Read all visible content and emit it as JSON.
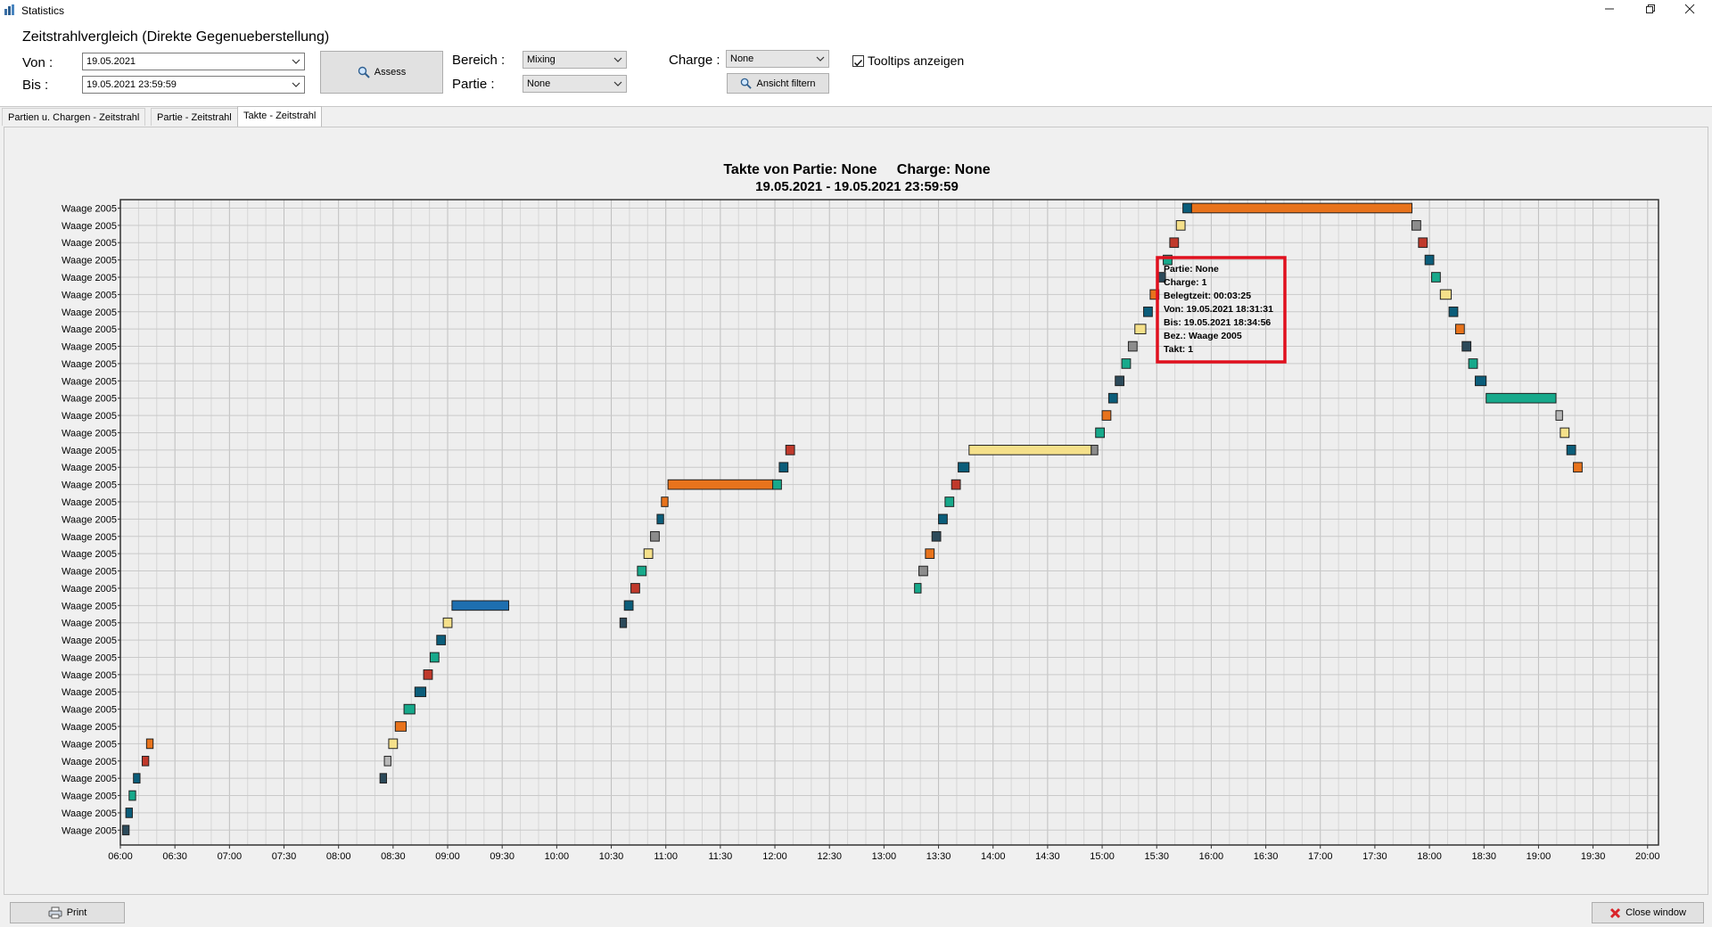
{
  "window": {
    "title": "Statistics",
    "minimize_icon": "minimize-icon",
    "maximize_icon": "restore-icon",
    "close_icon": "close-icon"
  },
  "filter": {
    "heading": "Zeitstrahlvergleich (Direkte Gegenueberstellung)",
    "von_label": "Von :",
    "von_value": "19.05.2021",
    "bis_label": "Bis :",
    "bis_value": "19.05.2021 23:59:59",
    "assess_label": "Assess",
    "bereich_label": "Bereich :",
    "bereich_value": "Mixing",
    "partie_label": "Partie :",
    "partie_value": "None",
    "charge_label": "Charge :",
    "charge_value": "None",
    "ansicht_label": "Ansicht filtern",
    "tooltips_label": "Tooltips anzeigen",
    "tooltips_checked": true
  },
  "tabs": [
    {
      "label": "Partien u. Chargen - Zeitstrahl",
      "active": false
    },
    {
      "label": "Partie - Zeitstrahl",
      "active": false
    },
    {
      "label": "Takte - Zeitstrahl",
      "active": true
    }
  ],
  "chart_data": {
    "type": "timeline",
    "title": "Takte von Partie: None     Charge: None",
    "subtitle": "19.05.2021 - 19.05.2021 23:59:59",
    "x_ticks": [
      "06:00",
      "06:30",
      "07:00",
      "07:30",
      "08:00",
      "08:30",
      "09:00",
      "09:30",
      "10:00",
      "10:30",
      "11:00",
      "11:30",
      "12:00",
      "12:30",
      "13:00",
      "13:30",
      "14:00",
      "14:30",
      "15:00",
      "15:30",
      "16:00",
      "16:30",
      "17:00",
      "17:30",
      "18:00",
      "18:30",
      "19:00",
      "19:30",
      "20:00"
    ],
    "x_range_hours": [
      6.0,
      20.1
    ],
    "y_label": "Waage 2005",
    "row_count": 37,
    "grid": true,
    "palette": [
      "#0b5d7a",
      "#17a98b",
      "#e8731c",
      "#c0392b",
      "#f5e08a",
      "#8c8c8c",
      "#2c4a5a",
      "#1e6fb0",
      "#b8b8b8"
    ],
    "segments": [
      {
        "row": 1,
        "start": 6.02,
        "end": 6.08,
        "color": "#2c4a5a"
      },
      {
        "row": 2,
        "start": 6.05,
        "end": 6.11,
        "color": "#0b5d7a"
      },
      {
        "row": 3,
        "start": 6.08,
        "end": 6.14,
        "color": "#17a98b"
      },
      {
        "row": 4,
        "start": 6.12,
        "end": 6.18,
        "color": "#0b5d7a"
      },
      {
        "row": 5,
        "start": 6.2,
        "end": 6.26,
        "color": "#c0392b"
      },
      {
        "row": 6,
        "start": 6.24,
        "end": 6.3,
        "color": "#e8731c"
      },
      {
        "row": 4,
        "start": 8.38,
        "end": 8.44,
        "color": "#2c4a5a"
      },
      {
        "row": 5,
        "start": 8.42,
        "end": 8.48,
        "color": "#b8b8b8"
      },
      {
        "row": 6,
        "start": 8.46,
        "end": 8.54,
        "color": "#f5e08a"
      },
      {
        "row": 7,
        "start": 8.52,
        "end": 8.62,
        "color": "#e8731c"
      },
      {
        "row": 8,
        "start": 8.6,
        "end": 8.7,
        "color": "#17a98b"
      },
      {
        "row": 9,
        "start": 8.7,
        "end": 8.8,
        "color": "#0b5d7a"
      },
      {
        "row": 10,
        "start": 8.78,
        "end": 8.86,
        "color": "#c0392b"
      },
      {
        "row": 11,
        "start": 8.84,
        "end": 8.92,
        "color": "#17a98b"
      },
      {
        "row": 12,
        "start": 8.9,
        "end": 8.98,
        "color": "#0b5d7a"
      },
      {
        "row": 13,
        "start": 8.96,
        "end": 9.04,
        "color": "#f5e08a"
      },
      {
        "row": 14,
        "start": 9.04,
        "end": 9.56,
        "color": "#1e6fb0"
      },
      {
        "row": 13,
        "start": 10.58,
        "end": 10.64,
        "color": "#2c4a5a"
      },
      {
        "row": 14,
        "start": 10.62,
        "end": 10.7,
        "color": "#0b5d7a"
      },
      {
        "row": 15,
        "start": 10.68,
        "end": 10.76,
        "color": "#c0392b"
      },
      {
        "row": 16,
        "start": 10.74,
        "end": 10.82,
        "color": "#17a98b"
      },
      {
        "row": 17,
        "start": 10.8,
        "end": 10.88,
        "color": "#f5e08a"
      },
      {
        "row": 18,
        "start": 10.86,
        "end": 10.94,
        "color": "#8c8c8c"
      },
      {
        "row": 19,
        "start": 10.92,
        "end": 10.98,
        "color": "#0b5d7a"
      },
      {
        "row": 20,
        "start": 10.96,
        "end": 11.02,
        "color": "#e8731c"
      },
      {
        "row": 21,
        "start": 11.02,
        "end": 11.98,
        "color": "#e8731c"
      },
      {
        "row": 21,
        "start": 11.98,
        "end": 12.06,
        "color": "#17a98b"
      },
      {
        "row": 22,
        "start": 12.04,
        "end": 12.12,
        "color": "#0b5d7a"
      },
      {
        "row": 23,
        "start": 12.1,
        "end": 12.18,
        "color": "#c0392b"
      },
      {
        "row": 15,
        "start": 13.28,
        "end": 13.34,
        "color": "#17a98b"
      },
      {
        "row": 16,
        "start": 13.32,
        "end": 13.4,
        "color": "#8c8c8c"
      },
      {
        "row": 17,
        "start": 13.38,
        "end": 13.46,
        "color": "#e8731c"
      },
      {
        "row": 18,
        "start": 13.44,
        "end": 13.52,
        "color": "#2c4a5a"
      },
      {
        "row": 19,
        "start": 13.5,
        "end": 13.58,
        "color": "#0b5d7a"
      },
      {
        "row": 20,
        "start": 13.56,
        "end": 13.64,
        "color": "#17a98b"
      },
      {
        "row": 21,
        "start": 13.62,
        "end": 13.7,
        "color": "#c0392b"
      },
      {
        "row": 22,
        "start": 13.68,
        "end": 13.78,
        "color": "#0b5d7a"
      },
      {
        "row": 23,
        "start": 13.78,
        "end": 14.9,
        "color": "#f5e08a"
      },
      {
        "row": 23,
        "start": 14.9,
        "end": 14.96,
        "color": "#8c8c8c"
      },
      {
        "row": 24,
        "start": 14.94,
        "end": 15.02,
        "color": "#17a98b"
      },
      {
        "row": 25,
        "start": 15.0,
        "end": 15.08,
        "color": "#e8731c"
      },
      {
        "row": 26,
        "start": 15.06,
        "end": 15.14,
        "color": "#0b5d7a"
      },
      {
        "row": 27,
        "start": 15.12,
        "end": 15.2,
        "color": "#2c4a5a"
      },
      {
        "row": 28,
        "start": 15.18,
        "end": 15.26,
        "color": "#17a98b"
      },
      {
        "row": 29,
        "start": 15.24,
        "end": 15.32,
        "color": "#8c8c8c"
      },
      {
        "row": 30,
        "start": 15.3,
        "end": 15.4,
        "color": "#f5e08a"
      },
      {
        "row": 31,
        "start": 15.38,
        "end": 15.46,
        "color": "#0b5d7a"
      },
      {
        "row": 32,
        "start": 15.44,
        "end": 15.52,
        "color": "#e8731c"
      },
      {
        "row": 33,
        "start": 15.5,
        "end": 15.58,
        "color": "#2c4a5a"
      },
      {
        "row": 34,
        "start": 15.56,
        "end": 15.64,
        "color": "#17a98b"
      },
      {
        "row": 35,
        "start": 15.62,
        "end": 15.7,
        "color": "#c0392b"
      },
      {
        "row": 36,
        "start": 15.68,
        "end": 15.76,
        "color": "#f5e08a"
      },
      {
        "row": 37,
        "start": 15.74,
        "end": 15.82,
        "color": "#0b5d7a"
      },
      {
        "row": 37,
        "start": 15.82,
        "end": 17.84,
        "color": "#e8731c"
      },
      {
        "row": 36,
        "start": 17.84,
        "end": 17.92,
        "color": "#8c8c8c"
      },
      {
        "row": 35,
        "start": 17.9,
        "end": 17.98,
        "color": "#c0392b"
      },
      {
        "row": 34,
        "start": 17.96,
        "end": 18.04,
        "color": "#0b5d7a"
      },
      {
        "row": 33,
        "start": 18.02,
        "end": 18.1,
        "color": "#17a98b"
      },
      {
        "row": 32,
        "start": 18.1,
        "end": 18.2,
        "color": "#f5e08a"
      },
      {
        "row": 31,
        "start": 18.18,
        "end": 18.26,
        "color": "#0b5d7a"
      },
      {
        "row": 30,
        "start": 18.24,
        "end": 18.32,
        "color": "#e8731c"
      },
      {
        "row": 29,
        "start": 18.3,
        "end": 18.38,
        "color": "#2c4a5a"
      },
      {
        "row": 28,
        "start": 18.36,
        "end": 18.44,
        "color": "#17a98b"
      },
      {
        "row": 27,
        "start": 18.42,
        "end": 18.52,
        "color": "#0b5d7a"
      },
      {
        "row": 26,
        "start": 18.52,
        "end": 19.16,
        "color": "#17a98b"
      },
      {
        "row": 25,
        "start": 19.16,
        "end": 19.22,
        "color": "#b8b8b8"
      },
      {
        "row": 24,
        "start": 19.2,
        "end": 19.28,
        "color": "#f5e08a"
      },
      {
        "row": 23,
        "start": 19.26,
        "end": 19.34,
        "color": "#0b5d7a"
      },
      {
        "row": 22,
        "start": 19.32,
        "end": 19.4,
        "color": "#e8731c"
      }
    ],
    "tooltip": {
      "lines": [
        "Partie: None",
        "Charge: 1",
        "Belegtzeit: 00:03:25",
        "Von: 19.05.2021 18:31:31",
        "Bis: 19.05.2021 18:34:56",
        "Bez.: Waage 2005",
        "Takt: 1"
      ],
      "border_color": "#e0101e"
    }
  },
  "footer": {
    "print_label": "Print",
    "close_label": "Close window",
    "close_icon_color": "#d9242a"
  }
}
